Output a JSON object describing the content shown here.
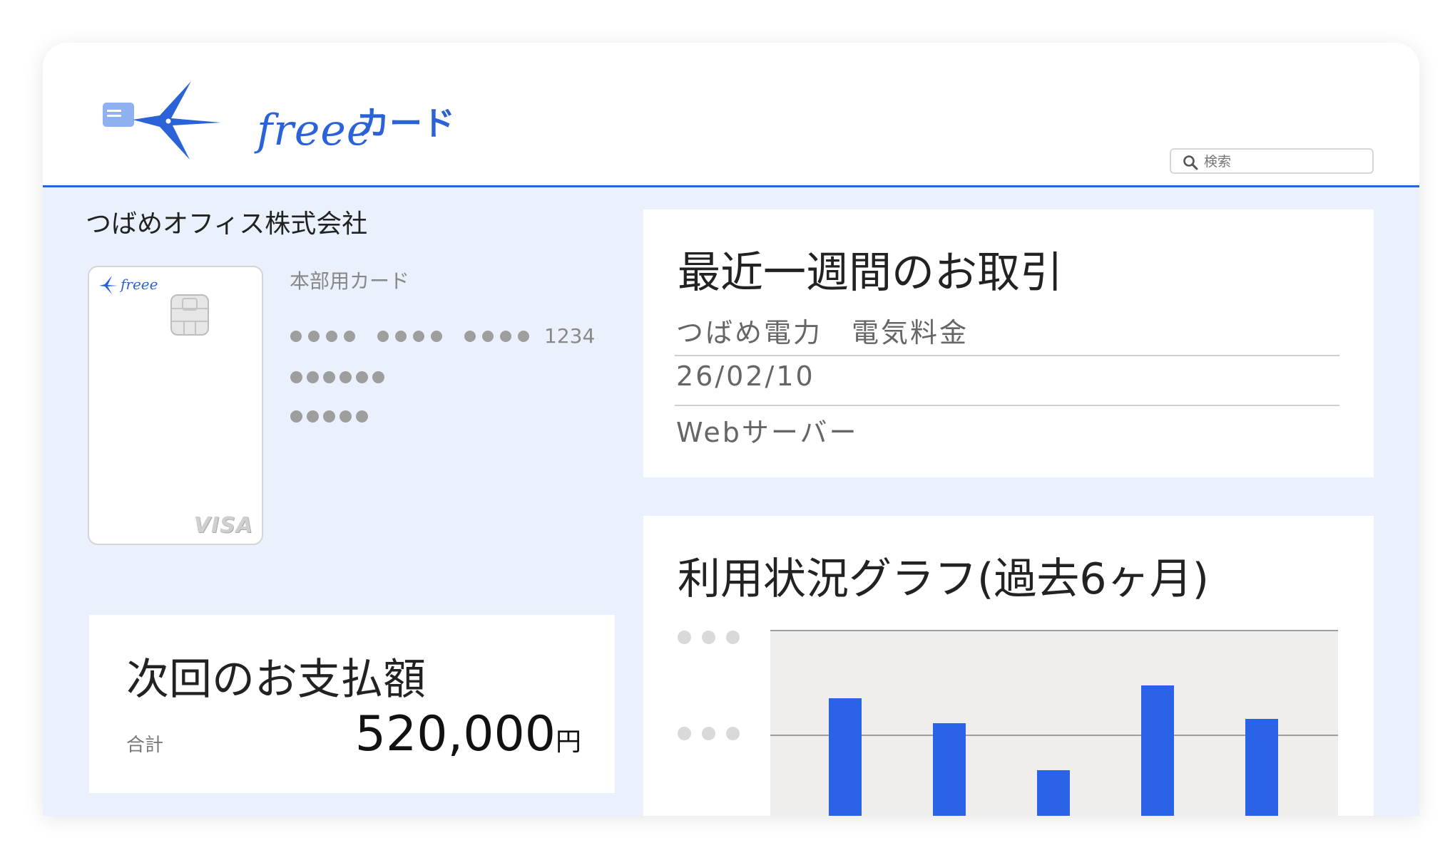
{
  "app": {
    "logo_text": "freee",
    "logo_sub": "カード",
    "brand_color": "#2c62d8"
  },
  "search": {
    "placeholder": "検索",
    "icon": "search-icon"
  },
  "account": {
    "company_name": "つばめオフィス株式会社",
    "card": {
      "logo_text": "freee",
      "network": "VISA",
      "name": "本部用カード",
      "last4": "1234"
    }
  },
  "payment": {
    "title": "次回のお支払額",
    "total_label": "合計",
    "amount": "520,000",
    "unit": "円"
  },
  "transactions": {
    "title": "最近一週間のお取引",
    "rows": [
      "つばめ電力　電気料金",
      "26/02/10",
      "Webサーバー"
    ]
  },
  "usage_graph": {
    "title": "利用状況グラフ(過去6ヶ月)",
    "bar_color": "#2b63e8",
    "chart_data": {
      "type": "bar",
      "values": [
        60,
        48,
        25,
        66,
        50
      ],
      "ylim": [
        0,
        93
      ]
    }
  }
}
